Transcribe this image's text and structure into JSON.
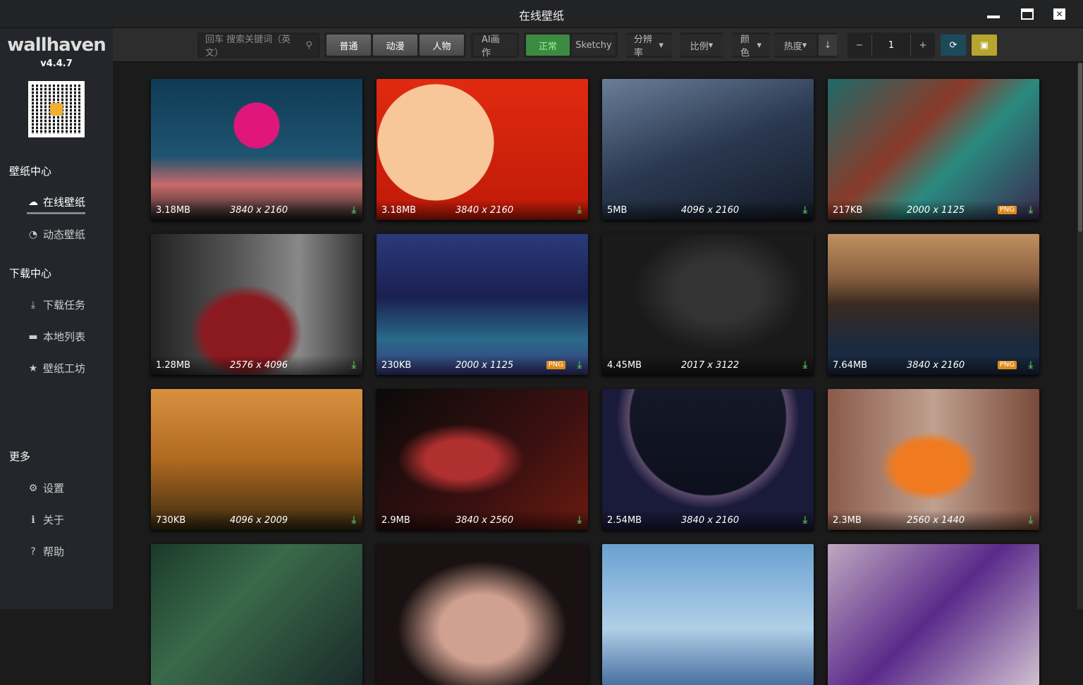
{
  "window": {
    "title": "在线壁纸"
  },
  "sidebar": {
    "logo": "wallhaven",
    "version": "v4.4.7",
    "sections": [
      {
        "title": "壁纸中心"
      },
      {
        "title": "下载中心"
      },
      {
        "title": "更多"
      }
    ],
    "items": [
      {
        "label": "在线壁纸",
        "icon": "☁"
      },
      {
        "label": "动态壁纸",
        "icon": "◔"
      },
      {
        "label": "下载任务",
        "icon": "⤓"
      },
      {
        "label": "本地列表",
        "icon": "▬"
      },
      {
        "label": "壁纸工坊",
        "icon": "★"
      },
      {
        "label": "设置",
        "icon": "⚙"
      },
      {
        "label": "关于",
        "icon": "ℹ"
      },
      {
        "label": "帮助",
        "icon": "?"
      }
    ]
  },
  "toolbar": {
    "search_placeholder": "回车 搜索关键词（英文）",
    "categories": [
      "普通",
      "动漫",
      "人物"
    ],
    "ai": "AI画作",
    "purity": [
      "正常",
      "Sketchy"
    ],
    "filters": [
      "分辨率",
      "比例",
      "颜色",
      "热度"
    ],
    "sort_dir": "↓",
    "page": "1",
    "minus": "−",
    "plus": "+"
  },
  "colors": {
    "accent_green": "#3d8a42",
    "refresh": "#1d4a5a",
    "save": "#b8a530",
    "download": "#4caf50",
    "png_badge": "#e08a1a"
  },
  "cards": [
    {
      "size": "3.18MB",
      "res": "3840 x 2160",
      "png": false,
      "bg": "radial-gradient(circle at 50% 33% ,#e0167a 0 32px,transparent 33px),linear-gradient(#0f3a55,#1f5470 55%,#c86a6a 75%,#222 100%)"
    },
    {
      "size": "3.18MB",
      "res": "3840 x 2160",
      "png": false,
      "bg": "radial-gradient(circle at 28% 45%,#f7c79a 0 82px,transparent 83px),linear-gradient(#e02a10,#c01a08)"
    },
    {
      "size": "5MB",
      "res": "4096 x 2160",
      "png": false,
      "bg": "linear-gradient(160deg,#6a7e99,#2a3850 50%,#141b28)"
    },
    {
      "size": "217KB",
      "res": "2000 x 1125",
      "png": true,
      "bg": "linear-gradient(135deg,#1e6a68,#8a3a2a 40%,#2a8a80 60%,#3a2a50)"
    },
    {
      "size": "1.28MB",
      "res": "2576 x 4096",
      "png": false,
      "bg": "radial-gradient(ellipse at 45% 70%,#8a1a20 0 60px,transparent 80px),linear-gradient(90deg,#222,#555 40%,#888 70%,#333)"
    },
    {
      "size": "230KB",
      "res": "2000 x 1125",
      "png": true,
      "bg": "linear-gradient(#2a3a7a,#1a2050 45%,#2a6a8a 75%,#3a3a80)"
    },
    {
      "size": "4.45MB",
      "res": "2017 x 3122",
      "png": false,
      "bg": "radial-gradient(ellipse at 55% 40%,#333 0 60px,#1a1a1a 120px)"
    },
    {
      "size": "7.64MB",
      "res": "3840 x 2160",
      "png": true,
      "bg": "linear-gradient(#c09060,#8a6040 30%,#3a2a20 50%,#1a2a40 80%)"
    },
    {
      "size": "730KB",
      "res": "4096 x 2009",
      "png": false,
      "bg": "linear-gradient(#d89040,#b06a20 50%,#3a2a10)"
    },
    {
      "size": "2.9MB",
      "res": "3840 x 2560",
      "png": false,
      "bg": "radial-gradient(ellipse at 40% 50%,#b03030 0 50px,transparent 90px),linear-gradient(135deg,#0a0a0a,#3a1010 60%,#6a1a10)"
    },
    {
      "size": "2.54MB",
      "res": "3840 x 2160",
      "png": false,
      "bg": "radial-gradient(circle at 50% 20%,transparent 0 110px,#5a4a6a 112px,#1a1a3a 130px),linear-gradient(#141828,#0a0c18)"
    },
    {
      "size": "2.3MB",
      "res": "2560 x 1440",
      "png": false,
      "bg": "radial-gradient(ellipse at 48% 55%,#f07a20 0 50px,transparent 70px),linear-gradient(90deg,#8a5a4a,#c0a090 50%,#7a4a3a)"
    },
    {
      "size": "",
      "res": "",
      "png": false,
      "bg": "linear-gradient(135deg,#1a3a2a,#3a6a4a 40%,#1a2a2a)"
    },
    {
      "size": "",
      "res": "",
      "png": false,
      "bg": "radial-gradient(ellipse at 50% 60%,#d0a090 0 60px,#1a1212 120px)"
    },
    {
      "size": "",
      "res": "",
      "png": false,
      "bg": "linear-gradient(#6aa0d0,#b0d0e8 60%,#4a70a0)"
    },
    {
      "size": "",
      "res": "",
      "png": false,
      "bg": "linear-gradient(135deg,#c0a8c0,#5a2a8a 50%,#d0c0d0)"
    }
  ]
}
